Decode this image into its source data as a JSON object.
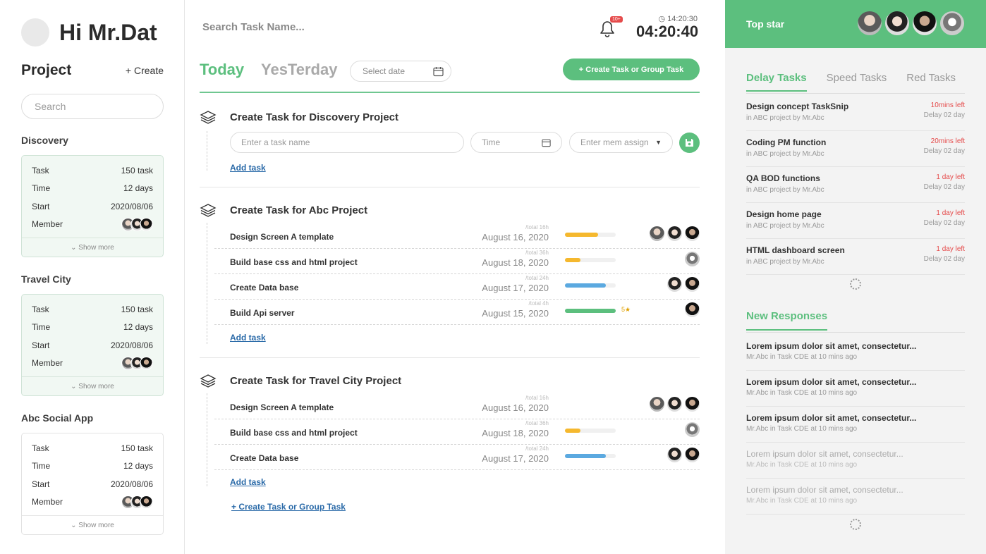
{
  "greeting": "Hi Mr.Dat",
  "sidebar": {
    "title": "Project",
    "create_label": "+ Create",
    "search_placeholder": "Search",
    "labels": {
      "task": "Task",
      "time": "Time",
      "start": "Start",
      "member": "Member",
      "show_more": "Show more"
    },
    "projects": [
      {
        "name": "Discovery",
        "task": "150 task",
        "time": "12 days",
        "start": "2020/08/06"
      },
      {
        "name": "Travel City",
        "task": "150 task",
        "time": "12 days",
        "start": "2020/08/06"
      },
      {
        "name": "Abc Social App",
        "task": "150 task",
        "time": "12 days",
        "start": "2020/08/06"
      }
    ]
  },
  "header": {
    "search_placeholder": "Search Task Name...",
    "badge": "10+",
    "clock_small": "14:20:30",
    "clock_big": "04:20:40"
  },
  "main": {
    "tab_today": "Today",
    "tab_yesterday": "YesTerday",
    "date_placeholder": "Select date",
    "create_button": "+ Create Task or Group Task",
    "add_task": "Add task",
    "bottom_create": "+ Create Task or Group Task",
    "sections": [
      {
        "title": "Create Task for Discovery Project",
        "inputs": {
          "task_placeholder": "Enter a task name",
          "time_placeholder": "Time",
          "member_placeholder": "Enter mem assign"
        }
      },
      {
        "title": "Create Task for Abc Project",
        "tasks": [
          {
            "name": "Design Screen A template",
            "total": "/total 16h",
            "date": "August 16, 2020",
            "progress": 0.65,
            "color": "#f5b82e",
            "avatars": [
              "a1",
              "a2",
              "a3"
            ]
          },
          {
            "name": "Build base css and html project",
            "total": "/total 36h",
            "date": "August 18, 2020",
            "progress": 0.3,
            "color": "#f5b82e",
            "avatars": [
              "a4"
            ]
          },
          {
            "name": "Create Data base",
            "total": "/total 24h",
            "date": "August 17, 2020",
            "progress": 0.8,
            "color": "#5ba9e0",
            "avatars": [
              "a2",
              "a3"
            ]
          },
          {
            "name": "Build Api server",
            "total": "/total 4h",
            "date": "August 15, 2020",
            "progress": 1.0,
            "color": "#5cbf7e",
            "rating": "5★",
            "avatars": [
              "a3"
            ]
          }
        ]
      },
      {
        "title": "Create Task for Travel City Project",
        "tasks": [
          {
            "name": "Design Screen A template",
            "total": "/total 16h",
            "date": "August 16, 2020",
            "avatars": [
              "a1",
              "a2",
              "a3"
            ]
          },
          {
            "name": "Build base css and html project",
            "total": "/total 36h",
            "date": "August 18, 2020",
            "progress": 0.3,
            "color": "#f5b82e",
            "avatars": [
              "a4"
            ]
          },
          {
            "name": "Create Data base",
            "total": "/total 24h",
            "date": "August 17, 2020",
            "progress": 0.8,
            "color": "#5ba9e0",
            "avatars": [
              "a2",
              "a3"
            ]
          }
        ]
      }
    ]
  },
  "right": {
    "top_star": "Top star",
    "tabs": [
      "Delay Tasks",
      "Speed Tasks",
      "Red Tasks"
    ],
    "delay_tasks": [
      {
        "name": "Design concept TaskSnip",
        "sub": "in ABC project by Mr.Abc",
        "left": "10mins left",
        "delay": "Delay 02 day"
      },
      {
        "name": "Coding PM function",
        "sub": "in ABC project by Mr.Abc",
        "left": "20mins left",
        "delay": "Delay 02 day"
      },
      {
        "name": "QA BOD functions",
        "sub": "in ABC project by Mr.Abc",
        "left": "1 day left",
        "delay": "Delay 02 day"
      },
      {
        "name": "Design home page",
        "sub": "in ABC project by Mr.Abc",
        "left": "1 day left",
        "delay": "Delay 02 day"
      },
      {
        "name": "HTML dashboard screen",
        "sub": "in ABC project by Mr.Abc",
        "left": "1 day left",
        "delay": "Delay 02 day"
      }
    ],
    "new_responses_title": "New Responses",
    "responses": [
      {
        "title": "Lorem ipsum dolor sit amet, consectetur...",
        "sub": "Mr.Abc in Task CDE at 10 mins ago"
      },
      {
        "title": "Lorem ipsum dolor sit amet, consectetur...",
        "sub": "Mr.Abc in Task CDE at 10 mins ago"
      },
      {
        "title": "Lorem ipsum dolor sit amet, consectetur...",
        "sub": "Mr.Abc in Task CDE at 10 mins ago"
      },
      {
        "title": "Lorem ipsum dolor sit amet, consectetur...",
        "sub": "Mr.Abc in Task CDE at 10 mins ago"
      },
      {
        "title": "Lorem ipsum dolor sit amet, consectetur...",
        "sub": "Mr.Abc in Task CDE at 10 mins ago"
      }
    ]
  }
}
